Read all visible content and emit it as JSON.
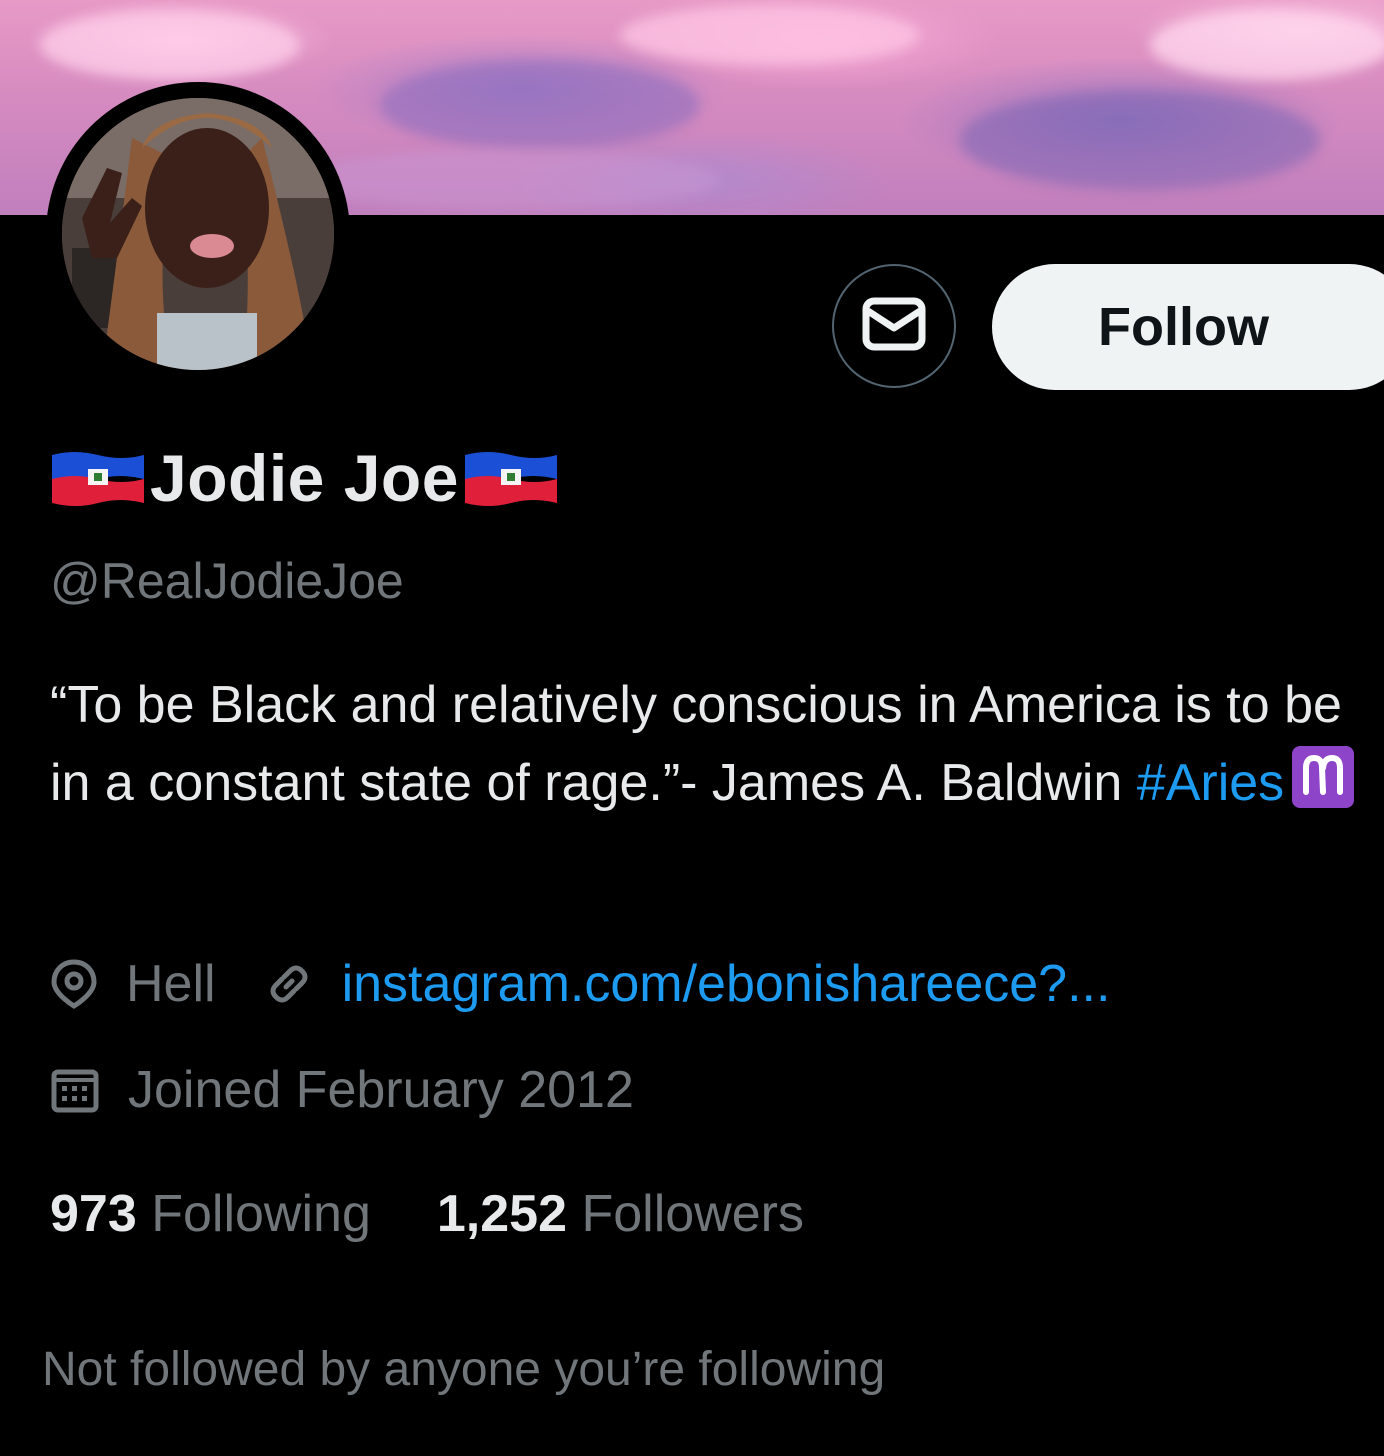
{
  "profile": {
    "display_name": "Jodie Joe",
    "handle": "@RealJodieJoe",
    "bio_text": "“To be Black and relatively conscious in America is to be in a constant state of rage.”- James A. Baldwin ",
    "bio_hashtag": "#Aries",
    "location": "Hell",
    "website": "instagram.com/ebonishareece?...",
    "joined": "Joined February 2012",
    "following_count": "973",
    "following_label": "Following",
    "followers_count": "1,252",
    "followers_label": "Followers",
    "mutuals_note": "Not followed by anyone you’re following"
  },
  "actions": {
    "follow_label": "Follow"
  },
  "icons": {
    "message": "mail-icon",
    "location": "location-pin-icon",
    "link": "link-icon",
    "calendar": "calendar-icon",
    "name_emoji": "haiti-flag",
    "bio_emoji": "aries-symbol"
  },
  "colors": {
    "accent": "#1d9bf0",
    "text_primary": "#e7e9ea",
    "text_secondary": "#71767b",
    "background": "#000000",
    "button_bg": "#eff3f4",
    "aries_bg": "#8e44c8"
  }
}
